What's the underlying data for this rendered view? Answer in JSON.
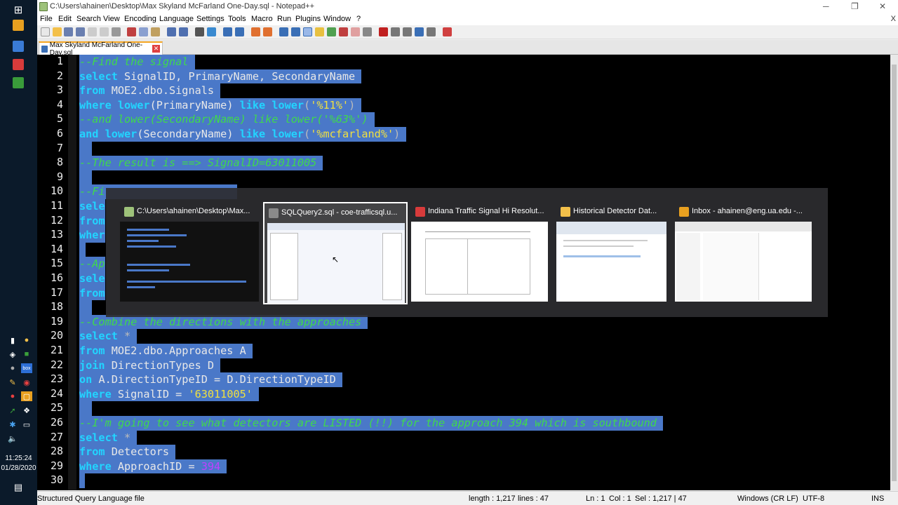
{
  "window": {
    "title": "C:\\Users\\ahainen\\Desktop\\Max Skyland McFarland One-Day.sql - Notepad++",
    "minimize": "─",
    "maximize": "❐",
    "close": "✕"
  },
  "menu": [
    "File",
    "Edit",
    "Search",
    "View",
    "Encoding",
    "Language",
    "Settings",
    "Tools",
    "Macro",
    "Run",
    "Plugins",
    "Window",
    "?"
  ],
  "menu_close": "X",
  "tab": {
    "label": "Max Skyland McFarland One-Day.sql",
    "close": "✕"
  },
  "line_numbers": [
    "1",
    "2",
    "3",
    "4",
    "5",
    "6",
    "7",
    "8",
    "9",
    "10",
    "11",
    "12",
    "13",
    "14",
    "15",
    "16",
    "17",
    "18",
    "19",
    "20",
    "21",
    "22",
    "23",
    "24",
    "25",
    "26",
    "27",
    "28",
    "29",
    "30"
  ],
  "code": {
    "l1": "--Find the signal",
    "l2a": "select",
    "l2b": " SignalID, PrimaryName, SecondaryName",
    "l3a": "from",
    "l3b": " MOE2.dbo.Signals",
    "l4a": "where",
    "l4b": " lower",
    "l4c": "(PrimaryName) ",
    "l4d": "like",
    "l4e": " lower",
    "l4f": "(",
    "l4g": "'%11%'",
    "l4h": ")",
    "l5": "--and lower(SecondaryName) like lower('%63%')",
    "l6a": "and",
    "l6b": " lower",
    "l6c": "(SecondaryName) ",
    "l6d": "like",
    "l6e": " lower",
    "l6f": "(",
    "l6g": "'%mcfarland%'",
    "l6h": ")",
    "l8": "--The result is ==> SignalID=63011005",
    "l10": "--Fi",
    "l11": "sele",
    "l12": "from",
    "l13": "wher",
    "l15": "--Ap",
    "l16": "sele",
    "l17": "from",
    "l19": "--Combine the directions with the approaches",
    "l20a": "select",
    "l20b": " *",
    "l21a": "from",
    "l21b": " MOE2.dbo.Approaches A",
    "l22a": "join",
    "l22b": " DirectionTypes D",
    "l23a": "on",
    "l23b": " A.DirectionTypeID = D.DirectionTypeID",
    "l24a": "where",
    "l24b": " SignalID = ",
    "l24c": "'63011005'",
    "l26": "--I'm going to see what detectors are LISTED (!!) for the approach 394 which is southbound",
    "l27a": "select",
    "l27b": " *",
    "l28a": "from",
    "l28b": " Detectors",
    "l29a": "where",
    "l29b": " ApproachID = ",
    "l29c": "394"
  },
  "status": {
    "file_type": "Structured Query Language file",
    "length": "length : 1,217",
    "lines": "lines : 47",
    "ln": "Ln : 1",
    "col": "Col : 1",
    "sel": "Sel : 1,217 | 47",
    "eol": "Windows (CR LF)",
    "encoding": "UTF-8",
    "mode": "INS"
  },
  "clock": {
    "time": "11:25:24",
    "date": "01/28/2020"
  },
  "switcher": [
    {
      "label": "C:\\Users\\ahainen\\Desktop\\Max...",
      "icon": "notepadpp-icon",
      "color": "#9ec27a"
    },
    {
      "label": "SQLQuery2.sql - coe-trafficsql.u...",
      "icon": "ssms-icon",
      "color": "#8a8a8a"
    },
    {
      "label": "Indiana Traffic Signal Hi Resolut...",
      "icon": "pdf-icon",
      "color": "#d83b3b"
    },
    {
      "label": "Historical Detector Dat...",
      "icon": "mail-icon",
      "color": "#f3c04a"
    },
    {
      "label": "Inbox - ahainen@eng.ua.edu -...",
      "icon": "outlook-icon",
      "color": "#e8a020"
    }
  ]
}
